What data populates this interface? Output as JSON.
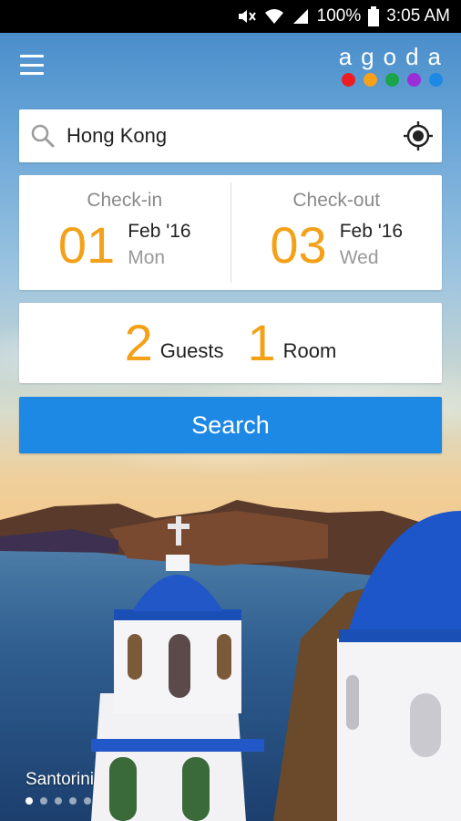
{
  "status_bar": {
    "battery": "100%",
    "time": "3:05 AM"
  },
  "brand": {
    "logo_text": "agoda",
    "dot_colors": [
      "#ee1d23",
      "#f7a11a",
      "#1aa54b",
      "#9b2ed6",
      "#1e88e5"
    ]
  },
  "search": {
    "value": "Hong Kong",
    "placeholder": ""
  },
  "checkin": {
    "label": "Check-in",
    "day": "01",
    "month": "Feb '16",
    "weekday": "Mon"
  },
  "checkout": {
    "label": "Check-out",
    "day": "03",
    "month": "Feb '16",
    "weekday": "Wed"
  },
  "occupancy": {
    "guests_count": "2",
    "guests_label": "Guests",
    "rooms_count": "1",
    "rooms_label": "Room"
  },
  "search_button": {
    "label": "Search"
  },
  "destination": {
    "name": "Santorini"
  },
  "pager": {
    "total": 5,
    "active_index": 0
  },
  "colors": {
    "accent": "#f4a11a",
    "primary": "#1e88e5"
  },
  "icons": [
    "menu-icon",
    "search-icon",
    "my-location-icon",
    "mute-icon",
    "wifi-icon",
    "signal-icon",
    "battery-icon"
  ]
}
